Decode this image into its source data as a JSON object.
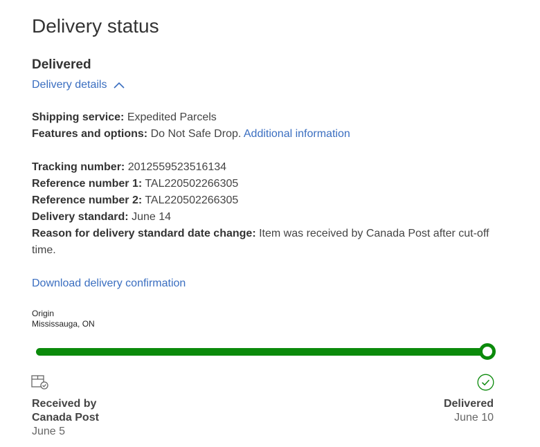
{
  "page": {
    "title": "Delivery status",
    "status": "Delivered",
    "details_link": "Delivery details"
  },
  "info": {
    "shipping_service_label": "Shipping service:",
    "shipping_service_value": "Expedited Parcels",
    "features_label": "Features and options:",
    "features_value": "Do Not Safe Drop.",
    "features_link": "Additional information",
    "tracking_label": "Tracking number:",
    "tracking_value": "2012559523516134",
    "ref1_label": "Reference number 1:",
    "ref1_value": "TAL220502266305",
    "ref2_label": "Reference number 2:",
    "ref2_value": "TAL220502266305",
    "standard_label": "Delivery standard:",
    "standard_value": "June 14",
    "reason_label": "Reason for delivery standard date change:",
    "reason_value": "Item was received by Canada Post after cut-off time."
  },
  "download_link": "Download delivery confirmation",
  "origin": {
    "label": "Origin",
    "location": "Mississauga, ON"
  },
  "progress": {
    "fraction": 1.0,
    "color": "#0b8a0b"
  },
  "events": {
    "start": {
      "icon": "parcel-received-icon",
      "title_line1": "Received by",
      "title_line2": "Canada Post",
      "date": "June 5"
    },
    "end": {
      "icon": "check-circle-icon",
      "title": "Delivered",
      "date": "June 10"
    }
  },
  "colors": {
    "accent_link": "#3a6ec0",
    "success": "#0b8a0b"
  }
}
